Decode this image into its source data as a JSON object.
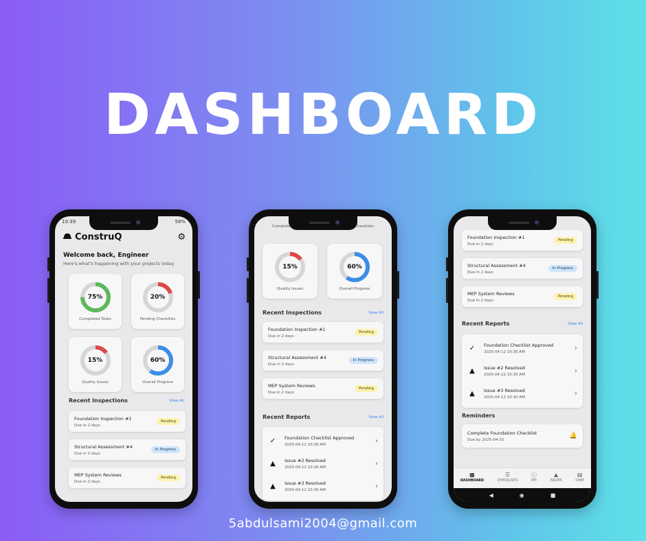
{
  "hero": {
    "title": "DASHBOARD"
  },
  "footer": {
    "email": "5abdulsami2004@gmail.com"
  },
  "status": {
    "time": "10:39",
    "battery": "58%"
  },
  "app": {
    "name": "ConstruQ"
  },
  "welcome": {
    "title": "Welcome back, Engineer",
    "subtitle": "Here's what's happening with your projects today"
  },
  "stats": [
    {
      "value": "75%",
      "fraction": 0.75,
      "label": "Completed Tasks",
      "color": "#5cb85c"
    },
    {
      "value": "20%",
      "fraction": 0.2,
      "label": "Pending Checklists",
      "color": "#e04848"
    },
    {
      "value": "15%",
      "fraction": 0.15,
      "label": "Quality Issues",
      "color": "#e04848"
    },
    {
      "value": "60%",
      "fraction": 0.6,
      "label": "Overall Progress",
      "color": "#3b8ee6"
    }
  ],
  "partial_stat_labels": {
    "left": "Completed Tasks",
    "right": "Pending Checklists"
  },
  "inspections": {
    "title": "Recent Inspections",
    "view_all": "View All",
    "items": [
      {
        "title": "Foundation Inspection #1",
        "due": "Due in 2 days",
        "status": "Pending"
      },
      {
        "title": "Structural Assessment #4",
        "due": "Due in 2 days",
        "status": "In Progress"
      },
      {
        "title": "MEP System Reviews",
        "due": "Due in 2 days",
        "status": "Pending"
      }
    ]
  },
  "reports": {
    "title": "Recent Reports",
    "view_all": "View All",
    "items": [
      {
        "title": "Foundation Checklist Approved",
        "time": "2025-04-12 10:30 AM",
        "icon": "check-icon"
      },
      {
        "title": "Issue #2 Resolved",
        "time": "2025-04-12 10:30 AM",
        "icon": "warning-icon"
      },
      {
        "title": "Issue #3 Resolved",
        "time": "2025-04-12 10:30 AM",
        "icon": "warning-icon"
      }
    ]
  },
  "reminders": {
    "title": "Reminders",
    "items": [
      {
        "title": "Complete Foundation Checklist",
        "due": "Due by 2025-04-15"
      }
    ]
  },
  "nav": [
    {
      "label": "DASHBOARD",
      "icon": "grid-icon",
      "active": true
    },
    {
      "label": "CHECKLISTS",
      "icon": "checklist-icon",
      "active": false
    },
    {
      "label": "RFI",
      "icon": "info-icon",
      "active": false
    },
    {
      "label": "ISSUES",
      "icon": "warning-icon",
      "active": false
    },
    {
      "label": "CHAT",
      "icon": "chat-icon",
      "active": false
    }
  ]
}
